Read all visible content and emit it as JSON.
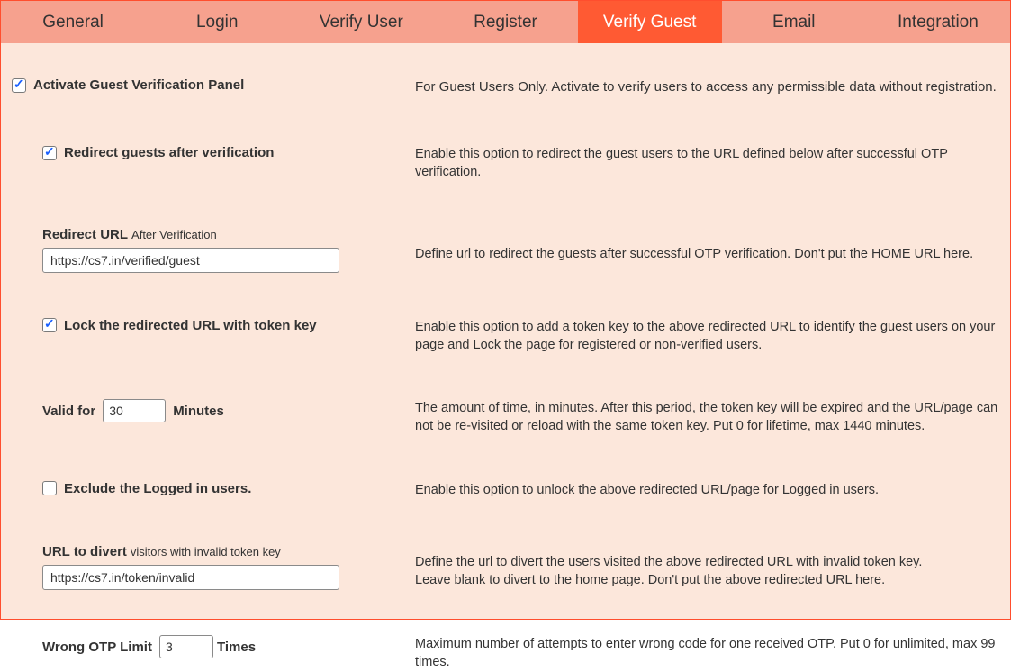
{
  "tabs": {
    "general": "General",
    "login": "Login",
    "verify_user": "Verify User",
    "register": "Register",
    "verify_guest": "Verify Guest",
    "email": "Email",
    "integration": "Integration"
  },
  "activate": {
    "label": "Activate Guest Verification Panel",
    "desc": "For Guest Users Only. Activate to verify users to access any permissible data without registration."
  },
  "redirect_guests": {
    "label": "Redirect guests after verification",
    "desc": "Enable this option to redirect the guest users to the URL defined below after successful OTP verification."
  },
  "redirect_url": {
    "label": "Redirect URL",
    "sub": "After Verification",
    "value": "https://cs7.in/verified/guest",
    "desc": "Define url to redirect the guests after successful OTP verification. Don't put the HOME URL here."
  },
  "lock_url": {
    "label": "Lock the redirected URL with token key",
    "desc": "Enable this option to add a token key to the above redirected URL to identify the guest users on your page and Lock the page for registered or non-verified users."
  },
  "valid_for": {
    "prefix": "Valid for",
    "value": "30",
    "suffix": "Minutes",
    "desc": "The amount of time, in minutes. After this period, the token key will be expired and the URL/page can not be re-visited or reload with the same token key. Put 0 for lifetime, max 1440 minutes."
  },
  "exclude_logged": {
    "label": "Exclude the Logged in users.",
    "desc": "Enable this option to unlock the above redirected URL/page for Logged in users."
  },
  "divert_url": {
    "label": "URL to divert",
    "sub": "visitors with invalid token key",
    "value": "https://cs7.in/token/invalid",
    "desc_l1": "Define the url to divert the users visited the above redirected URL with invalid token key.",
    "desc_l2": "Leave blank to divert to the home page. Don't put the above redirected URL here."
  },
  "wrong_otp": {
    "prefix": "Wrong OTP Limit",
    "value": "3",
    "suffix": "Times",
    "desc": "Maximum number of attempts to enter wrong code for one received OTP. Put 0 for unlimited, max 99 times."
  }
}
